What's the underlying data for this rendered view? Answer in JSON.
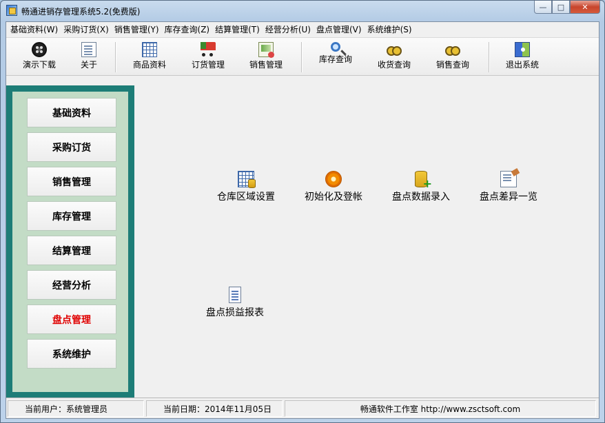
{
  "window": {
    "title": "畅通进销存管理系统5.2(免费版)",
    "buttons": {
      "minimize": "—",
      "maximize": "□",
      "close": "✕"
    }
  },
  "menu": [
    "基础资料(W)",
    "采购订货(X)",
    "销售管理(Y)",
    "库存查询(Z)",
    "结算管理(T)",
    "经营分析(U)",
    "盘点管理(V)",
    "系统维护(S)"
  ],
  "toolbar": [
    {
      "label": "演示下载",
      "icon": "film-reel-icon"
    },
    {
      "label": "关于",
      "icon": "about-icon"
    },
    {
      "label": "商品资料",
      "icon": "product-grid-icon"
    },
    {
      "label": "订货管理",
      "icon": "truck-icon"
    },
    {
      "label": "销售管理",
      "icon": "sales-icon"
    },
    {
      "label": "库存查询",
      "icon": "magnifier-icon"
    },
    {
      "label": "收货查询",
      "icon": "binoculars-icon"
    },
    {
      "label": "销售查询",
      "icon": "binoculars-icon"
    },
    {
      "label": "退出系统",
      "icon": "exit-door-icon"
    }
  ],
  "sidebar": {
    "items": [
      {
        "label": "基础资料",
        "active": false
      },
      {
        "label": "采购订货",
        "active": false
      },
      {
        "label": "销售管理",
        "active": false
      },
      {
        "label": "库存管理",
        "active": false
      },
      {
        "label": "结算管理",
        "active": false
      },
      {
        "label": "经营分析",
        "active": false
      },
      {
        "label": "盘点管理",
        "active": true
      },
      {
        "label": "系统维护",
        "active": false
      }
    ],
    "active_color": "#e00000",
    "frame_color": "#1d7d77",
    "inner_color": "#c3dcc6"
  },
  "content": {
    "items": [
      {
        "label": "仓库区域设置",
        "icon": "warehouse-grid-icon"
      },
      {
        "label": "初始化及登帐",
        "icon": "init-coin-icon"
      },
      {
        "label": "盘点数据录入",
        "icon": "database-add-icon"
      },
      {
        "label": "盘点差异一览",
        "icon": "difference-doc-icon"
      },
      {
        "label": "盘点损益报表",
        "icon": "report-doc-icon"
      }
    ]
  },
  "status": {
    "user": "当前用户：系统管理员",
    "date": "当前日期：2014年11月05日",
    "company": "畅通软件工作室 http://www.zsctsoft.com"
  }
}
